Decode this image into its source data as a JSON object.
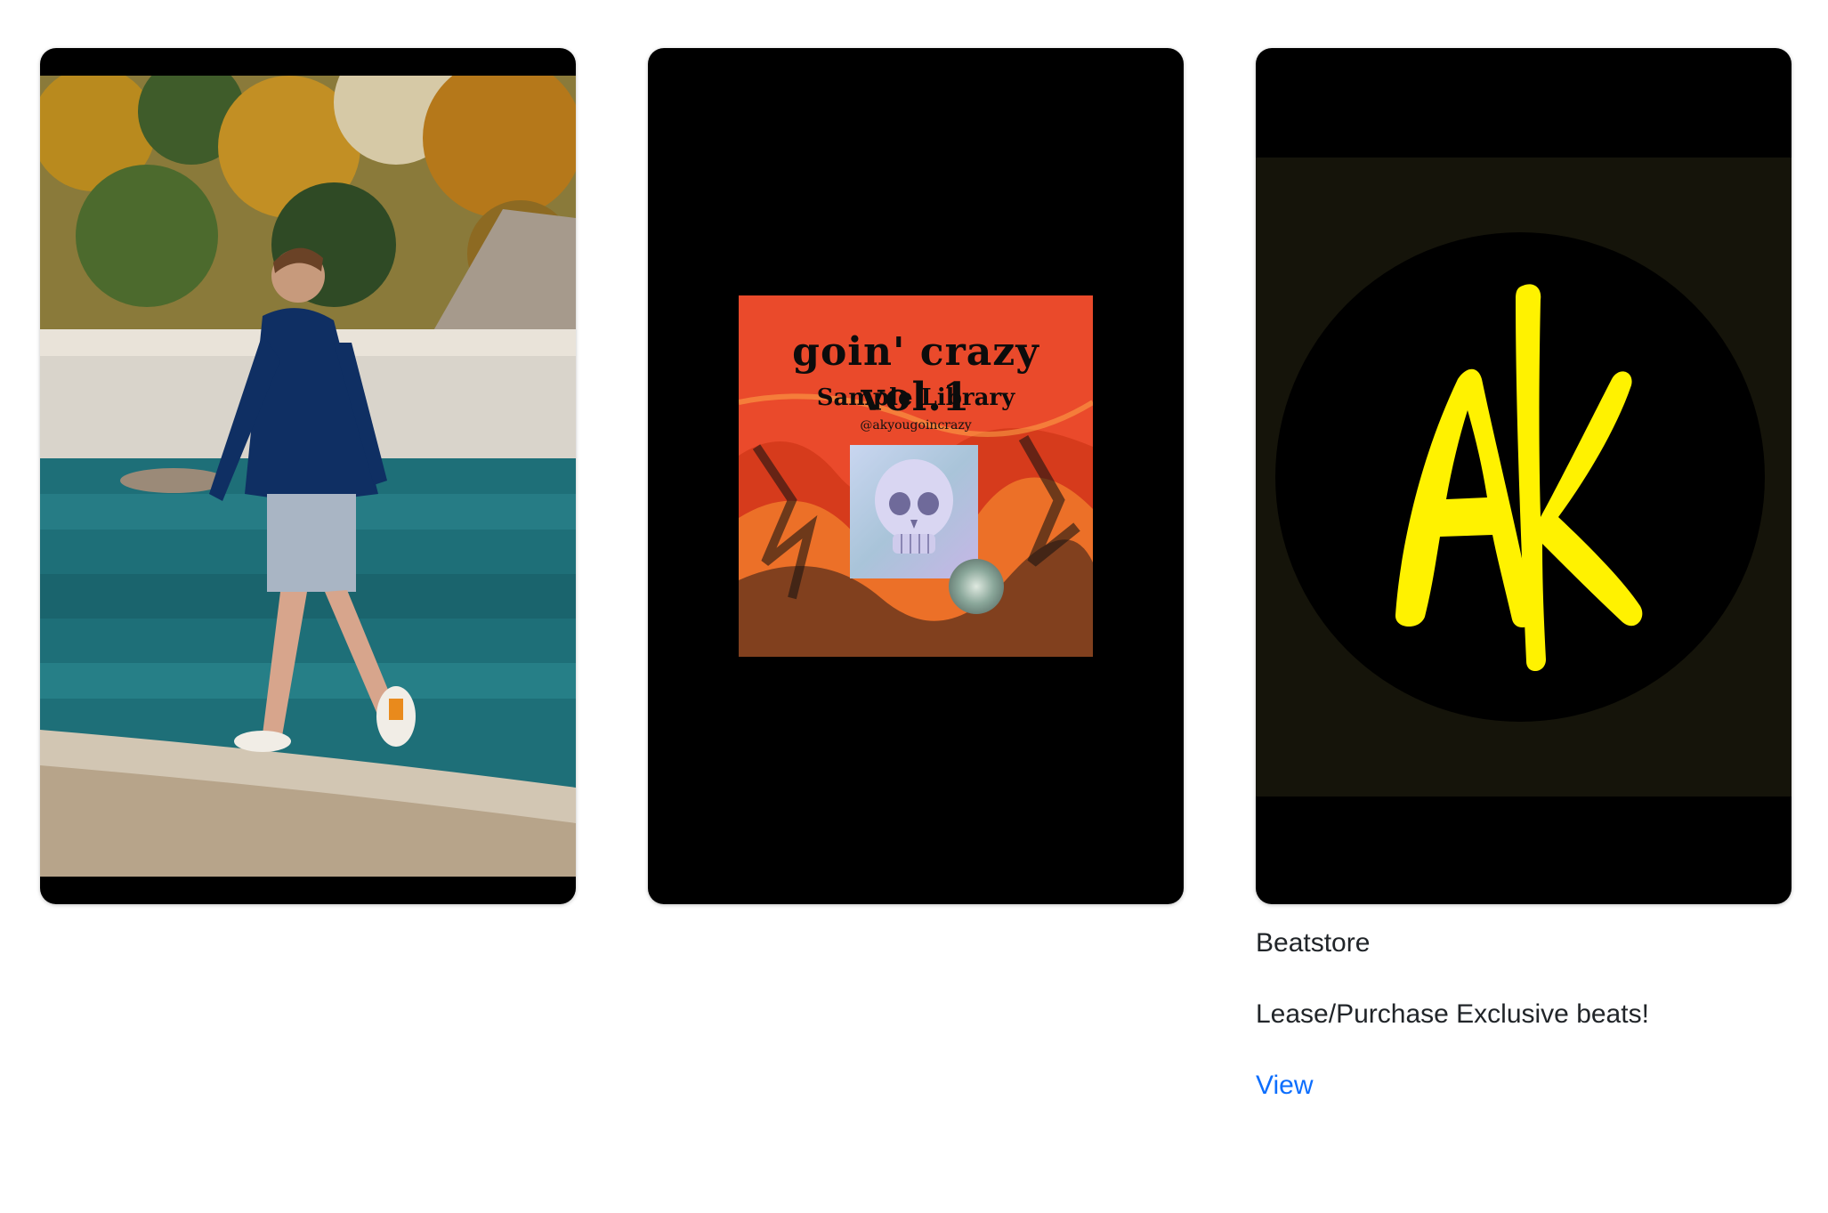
{
  "cards": [
    {
      "image": "photo-man-walking-by-sea"
    },
    {
      "image": "album-cover",
      "album": {
        "title": "goin' crazy vol.1",
        "subtitle": "Sample Library",
        "handle": "@akyougoincrazy"
      }
    },
    {
      "image": "ak-logo",
      "logo_text": "AK",
      "title": "Beatstore",
      "text": "Lease/Purchase Exclusive beats!",
      "link_label": "View"
    }
  ],
  "colors": {
    "link": "#0d6efd",
    "logo_yellow": "#fff200",
    "album_red": "#e8452a"
  }
}
